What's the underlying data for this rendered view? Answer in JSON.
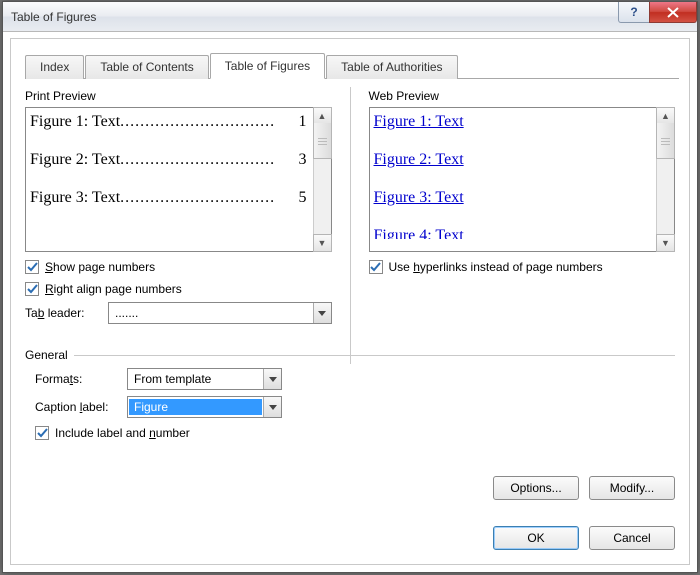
{
  "window": {
    "title": "Table of Figures"
  },
  "tabs": {
    "index": "Index",
    "contents": "Table of Contents",
    "figures": "Table of Figures",
    "authorities": "Table of Authorities"
  },
  "sections": {
    "print_preview": "Print Preview",
    "web_preview": "Web Preview",
    "general": "General"
  },
  "print_entries": [
    {
      "label": "Figure 1: Text",
      "page": "1"
    },
    {
      "label": "Figure 2: Text",
      "page": "3"
    },
    {
      "label": "Figure 3: Text",
      "page": "5"
    }
  ],
  "web_entries": [
    "Figure 1: Text",
    "Figure 2: Text",
    "Figure 3: Text",
    "Figure 4: Text"
  ],
  "checkboxes": {
    "show_page_numbers": {
      "label": "Show page numbers",
      "checked": true
    },
    "right_align": {
      "label": "Right align page numbers",
      "checked": true
    },
    "use_hyperlinks": {
      "label": "Use hyperlinks instead of page numbers",
      "checked": true
    },
    "include_label": {
      "label": "Include label and number",
      "checked": true
    }
  },
  "fields": {
    "tab_leader": {
      "label": "Tab leader:",
      "value": "......."
    },
    "formats": {
      "label": "Formats:",
      "value": "From template"
    },
    "caption_label": {
      "label": "Caption label:",
      "value": "Figure"
    }
  },
  "buttons": {
    "options": "Options...",
    "modify": "Modify...",
    "ok": "OK",
    "cancel": "Cancel",
    "help": "?",
    "close": "X"
  },
  "dots": "..............................."
}
